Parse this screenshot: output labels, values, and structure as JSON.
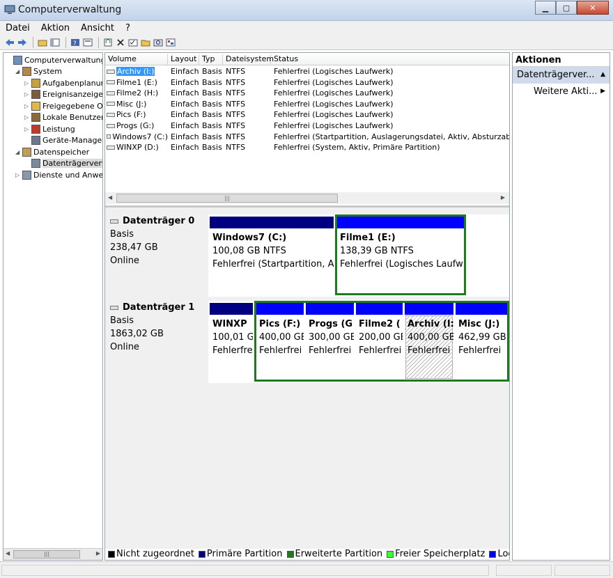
{
  "window": {
    "title": "Computerverwaltung",
    "minimize_glyph": "▁",
    "maximize_glyph": "▢",
    "close_glyph": "✕"
  },
  "menu": [
    "Datei",
    "Aktion",
    "Ansicht",
    "?"
  ],
  "tree": [
    {
      "label": "Computerverwaltung (Lo",
      "icon": "computer-icon",
      "indent": 0,
      "arrow": ""
    },
    {
      "label": "System",
      "icon": "tools-icon",
      "indent": 1,
      "arrow": "◢"
    },
    {
      "label": "Aufgabenplanung",
      "icon": "clock-icon",
      "indent": 2,
      "arrow": "▷"
    },
    {
      "label": "Ereignisanzeige",
      "icon": "event-icon",
      "indent": 2,
      "arrow": "▷"
    },
    {
      "label": "Freigegebene Ordr",
      "icon": "folder-icon",
      "indent": 2,
      "arrow": "▷"
    },
    {
      "label": "Lokale Benutzer un",
      "icon": "users-icon",
      "indent": 2,
      "arrow": "▷"
    },
    {
      "label": "Leistung",
      "icon": "performance-icon",
      "indent": 2,
      "arrow": "▷"
    },
    {
      "label": "Geräte-Manager",
      "icon": "device-icon",
      "indent": 2,
      "arrow": ""
    },
    {
      "label": "Datenspeicher",
      "icon": "storage-icon",
      "indent": 1,
      "arrow": "◢"
    },
    {
      "label": "Datenträgerverwalt",
      "icon": "disk-icon",
      "indent": 2,
      "arrow": "",
      "selected": true
    },
    {
      "label": "Dienste und Anwendu",
      "icon": "services-icon",
      "indent": 1,
      "arrow": "▷"
    }
  ],
  "tree_scroll_grip": "|||",
  "volume_table": {
    "headers": [
      "Volume",
      "Layout",
      "Typ",
      "Dateisystem",
      "Status"
    ],
    "rows": [
      {
        "volume": "Archiv (I:)",
        "layout": "Einfach",
        "typ": "Basis",
        "fs": "NTFS",
        "status": "Fehlerfrei (Logisches Laufwerk)",
        "selected": true
      },
      {
        "volume": "Filme1 (E:)",
        "layout": "Einfach",
        "typ": "Basis",
        "fs": "NTFS",
        "status": "Fehlerfrei (Logisches Laufwerk)"
      },
      {
        "volume": "Filme2 (H:)",
        "layout": "Einfach",
        "typ": "Basis",
        "fs": "NTFS",
        "status": "Fehlerfrei (Logisches Laufwerk)"
      },
      {
        "volume": "Misc (J:)",
        "layout": "Einfach",
        "typ": "Basis",
        "fs": "NTFS",
        "status": "Fehlerfrei (Logisches Laufwerk)"
      },
      {
        "volume": "Pics (F:)",
        "layout": "Einfach",
        "typ": "Basis",
        "fs": "NTFS",
        "status": "Fehlerfrei (Logisches Laufwerk)"
      },
      {
        "volume": "Progs (G:)",
        "layout": "Einfach",
        "typ": "Basis",
        "fs": "NTFS",
        "status": "Fehlerfrei (Logisches Laufwerk)"
      },
      {
        "volume": "Windows7 (C:)",
        "layout": "Einfach",
        "typ": "Basis",
        "fs": "NTFS",
        "status": "Fehlerfrei (Startpartition, Auslagerungsdatei, Aktiv, Absturzabbild, Pr"
      },
      {
        "volume": "WINXP (D:)",
        "layout": "Einfach",
        "typ": "Basis",
        "fs": "NTFS",
        "status": "Fehlerfrei (System, Aktiv, Primäre Partition)"
      }
    ],
    "scroll_grip": "|||"
  },
  "disks": [
    {
      "name": "Datenträger 0",
      "type": "Basis",
      "size": "238,47 GB",
      "state": "Online",
      "partitions": [
        {
          "name": "Windows7  (C:)",
          "size": "100,08 GB NTFS",
          "status": "Fehlerfrei (Startpartition, Au",
          "kind": "primary"
        },
        {
          "name": "Filme1  (E:)",
          "size": "138,39 GB NTFS",
          "status": "Fehlerfrei (Logisches Laufw",
          "kind": "logical"
        }
      ]
    },
    {
      "name": "Datenträger 1",
      "type": "Basis",
      "size": "1863,02 GB",
      "state": "Online",
      "partitions": [
        {
          "name": "WINXP",
          "size": "100,01 G",
          "status": "Fehlerfre",
          "kind": "primary"
        },
        {
          "name": "Pics  (F:)",
          "size": "400,00 GE",
          "status": "Fehlerfrei",
          "kind": "logical"
        },
        {
          "name": "Progs  (G",
          "size": "300,00 GE",
          "status": "Fehlerfrei",
          "kind": "logical"
        },
        {
          "name": "Filme2  (",
          "size": "200,00 GE",
          "status": "Fehlerfrei",
          "kind": "logical"
        },
        {
          "name": "Archiv  (I:",
          "size": "400,00 GB",
          "status": "Fehlerfrei",
          "kind": "logical",
          "selected": true
        },
        {
          "name": "Misc  (J:)",
          "size": "462,99 GB",
          "status": "Fehlerfrei",
          "kind": "logical"
        }
      ]
    }
  ],
  "legend": [
    {
      "label": "Nicht zugeordnet",
      "color": "#000000"
    },
    {
      "label": "Primäre Partition",
      "color": "#000080"
    },
    {
      "label": "Erweiterte Partition",
      "color": "#1d7a1d"
    },
    {
      "label": "Freier Speicherplatz",
      "color": "#33ff33"
    },
    {
      "label": "Logisc",
      "color": "#0000ff"
    }
  ],
  "actions": {
    "header": "Aktionen",
    "section": "Datenträgerver...",
    "item": "Weitere Akti..."
  },
  "colors": {
    "primary_bar": "#000080",
    "logical_bar": "#0000ff",
    "extended_frame": "#1d7a1d",
    "selection": "#3399ff"
  }
}
